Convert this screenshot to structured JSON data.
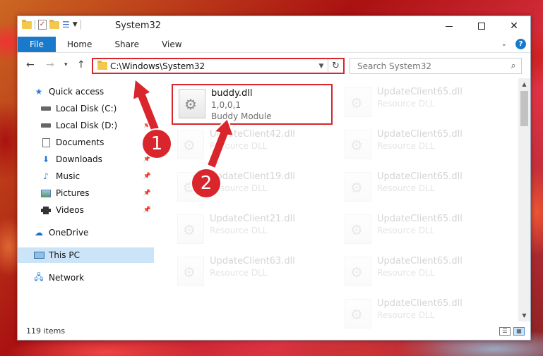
{
  "window": {
    "title": "System32"
  },
  "ribbon": {
    "file_label": "File",
    "tabs": [
      "Home",
      "Share",
      "View"
    ]
  },
  "address": {
    "path": "C:\\Windows\\System32",
    "search_placeholder": "Search System32"
  },
  "nav": [
    {
      "label": "Quick access",
      "icon": "star-icon",
      "pinned": false
    },
    {
      "label": "Local Disk (C:)",
      "icon": "drive-icon",
      "pinned": false
    },
    {
      "label": "Local Disk (D:)",
      "icon": "drive-icon",
      "pinned": true
    },
    {
      "label": "Documents",
      "icon": "documents-icon",
      "pinned": true
    },
    {
      "label": "Downloads",
      "icon": "downloads-icon",
      "pinned": true
    },
    {
      "label": "Music",
      "icon": "music-icon",
      "pinned": true
    },
    {
      "label": "Pictures",
      "icon": "pictures-icon",
      "pinned": true
    },
    {
      "label": "Videos",
      "icon": "videos-icon",
      "pinned": true
    },
    {
      "label": "OneDrive",
      "icon": "cloud-icon",
      "pinned": false
    },
    {
      "label": "This PC",
      "icon": "computer-icon",
      "pinned": false,
      "selected": true
    },
    {
      "label": "Network",
      "icon": "network-icon",
      "pinned": false
    }
  ],
  "files": [
    {
      "name": "buddy.dll",
      "version": "1,0,0,1",
      "desc": "Buddy Module",
      "highlighted": true
    },
    {
      "name": "UpdateClient65.dll",
      "desc": "Resource DLL"
    },
    {
      "name": "UpdateClient42.dll",
      "desc": "Resource DLL"
    },
    {
      "name": "UpdateClient65.dll",
      "desc": "Resource DLL"
    },
    {
      "name": "UpdateClient19.dll",
      "desc": "Resource DLL"
    },
    {
      "name": "UpdateClient65.dll",
      "desc": "Resource DLL"
    },
    {
      "name": "UpdateClient21.dll",
      "desc": "Resource DLL"
    },
    {
      "name": "UpdateClient65.dll",
      "desc": "Resource DLL"
    },
    {
      "name": "UpdateClient63.dll",
      "desc": "Resource DLL"
    },
    {
      "name": "UpdateClient65.dll",
      "desc": "Resource DLL"
    },
    {
      "name": "UpdateClient65.dll",
      "desc": "Resource DLL"
    }
  ],
  "status": {
    "item_count": "119 items"
  },
  "annotations": [
    "1",
    "2"
  ],
  "colors": {
    "accent": "#1979ca",
    "highlight": "#d8262c",
    "selected": "#cce4f7"
  }
}
